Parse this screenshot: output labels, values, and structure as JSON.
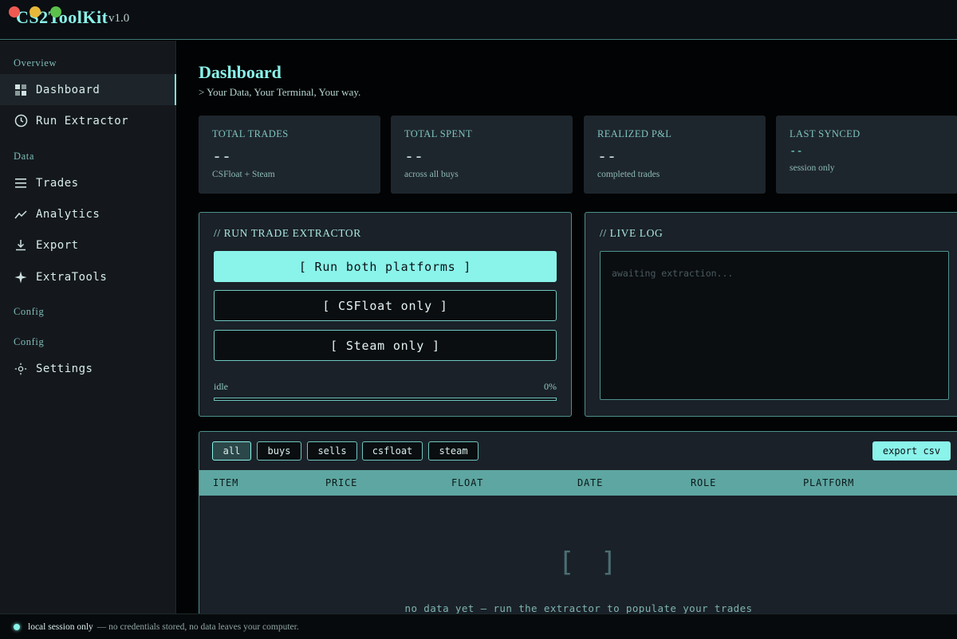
{
  "app": {
    "title": "CS2ToolKit",
    "version": "v1.0"
  },
  "sidebar": {
    "sections": [
      {
        "label": "Overview"
      },
      {
        "label": "Data"
      },
      {
        "label": "Config"
      },
      {
        "label": "Config"
      }
    ],
    "items": [
      {
        "label": "Dashboard",
        "icon": "grid-icon",
        "active": true
      },
      {
        "label": "Run Extractor",
        "icon": "clock-icon"
      },
      {
        "label": "Trades",
        "icon": "list-icon"
      },
      {
        "label": "Analytics",
        "icon": "trend-icon"
      },
      {
        "label": "Export",
        "icon": "download-icon"
      },
      {
        "label": "ExtraTools",
        "icon": "sparkle-icon"
      },
      {
        "label": "Settings",
        "icon": "sun-gear-icon"
      }
    ]
  },
  "header": {
    "title": "Dashboard",
    "subtitle": "> Your Data, Your Terminal, Your way."
  },
  "stats": [
    {
      "label": "TOTAL TRADES",
      "value": "--",
      "sub": "CSFloat + Steam"
    },
    {
      "label": "TOTAL SPENT",
      "value": "--",
      "sub": "across all buys"
    },
    {
      "label": "REALIZED P&L",
      "value": "--",
      "sub": "completed trades"
    },
    {
      "label": "LAST SYNCED",
      "value": "--",
      "sub": "session only"
    }
  ],
  "extractor": {
    "title": "// RUN TRADE EXTRACTOR",
    "buttons": [
      "[ Run both platforms ]",
      "[ CSFloat only ]",
      "[ Steam only ]"
    ],
    "status": "idle",
    "progress_label": "0%",
    "progress": 0
  },
  "log": {
    "title": "// LIVE LOG",
    "placeholder": "awaiting extraction..."
  },
  "trades": {
    "filters": [
      "all",
      "buys",
      "sells",
      "csfloat",
      "steam"
    ],
    "active_filter": "all",
    "export_label": "export csv",
    "columns": [
      "ITEM",
      "PRICE",
      "FLOAT",
      "DATE",
      "ROLE",
      "PLATFORM"
    ],
    "empty_mark": "[ ]",
    "empty_text": "no data yet — run the extractor to populate your trades"
  },
  "footer": {
    "strong": "local session only",
    "rest": "— no credentials stored, no data leaves your computer."
  },
  "colors": {
    "accent": "#8af3ea",
    "panel": "#1e262d",
    "border": "#4d918c"
  }
}
